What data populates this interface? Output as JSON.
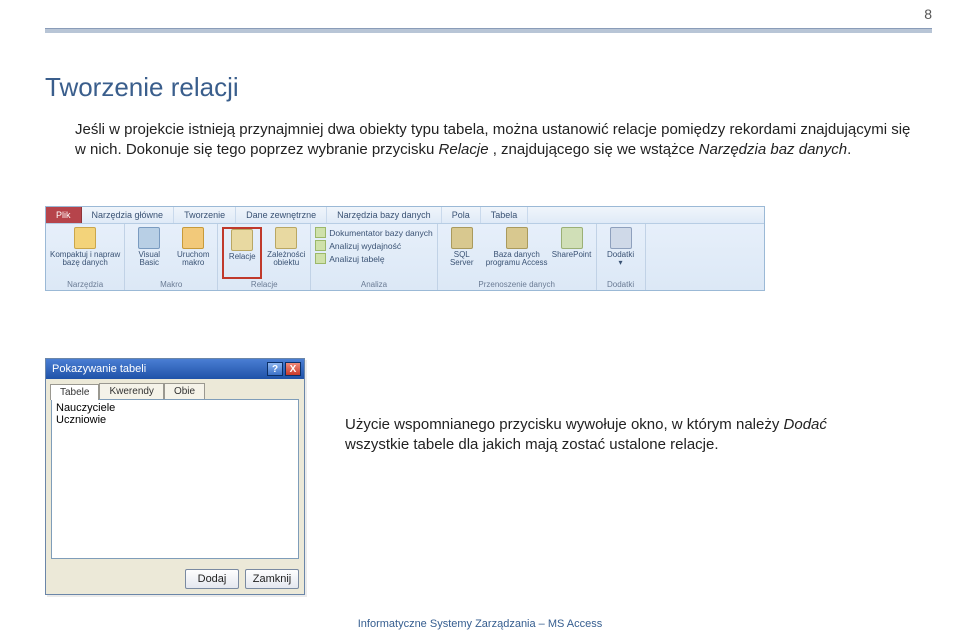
{
  "page_number": "8",
  "heading": "Tworzenie relacji",
  "paragraph": {
    "pre": "Jeśli w projekcie istnieją przynajmniej dwa obiekty typu tabela, można ustanowić relacje pomiędzy rekordami znajdującymi się w nich. Dokonuje się tego poprzez wybranie przycisku ",
    "em1": "Relacje",
    "mid": ", znajdującego się we wstążce ",
    "em2": "Narzędzia baz danych",
    "post": "."
  },
  "ribbon": {
    "tabs": [
      "Plik",
      "Narzędzia główne",
      "Tworzenie",
      "Dane zewnętrzne",
      "Narzędzia bazy danych",
      "Pola",
      "Tabela"
    ],
    "groups": [
      {
        "label": "Narzędzia",
        "big": [
          {
            "line1": "Kompaktuj i napraw",
            "line2": "bazę danych"
          }
        ]
      },
      {
        "label": "Makro",
        "big": [
          {
            "line1": "Visual",
            "line2": "Basic"
          },
          {
            "line1": "Uruchom",
            "line2": "makro"
          }
        ]
      },
      {
        "label": "Relacje",
        "big": [
          {
            "line1": "Relacje",
            "line2": "",
            "highlight": true
          },
          {
            "line1": "Zależności",
            "line2": "obiektu"
          }
        ]
      },
      {
        "label": "Analiza",
        "small": [
          "Dokumentator bazy danych",
          "Analizuj wydajność",
          "Analizuj tabelę"
        ]
      },
      {
        "label": "Przenoszenie danych",
        "big": [
          {
            "line1": "SQL",
            "line2": "Server"
          },
          {
            "line1": "Baza danych",
            "line2": "programu Access"
          },
          {
            "line1": "SharePoint",
            "line2": ""
          }
        ]
      },
      {
        "label": "Dodatki",
        "big": [
          {
            "line1": "Dodatki",
            "line2": "▾"
          }
        ]
      }
    ]
  },
  "dialog": {
    "title": "Pokazywanie tabeli",
    "help": "?",
    "close": "X",
    "tabs": [
      "Tabele",
      "Kwerendy",
      "Obie"
    ],
    "items": [
      "Nauczyciele",
      "Uczniowie"
    ],
    "buttons": {
      "add": "Dodaj",
      "close": "Zamknij"
    }
  },
  "side_note": {
    "pre": "Użycie wspomnianego przycisku wywołuje okno, w którym należy ",
    "em": "Dodać",
    "post": " wszystkie tabele dla jakich mają zostać ustalone relacje."
  },
  "footer": "Informatyczne Systemy Zarządzania – MS Access"
}
